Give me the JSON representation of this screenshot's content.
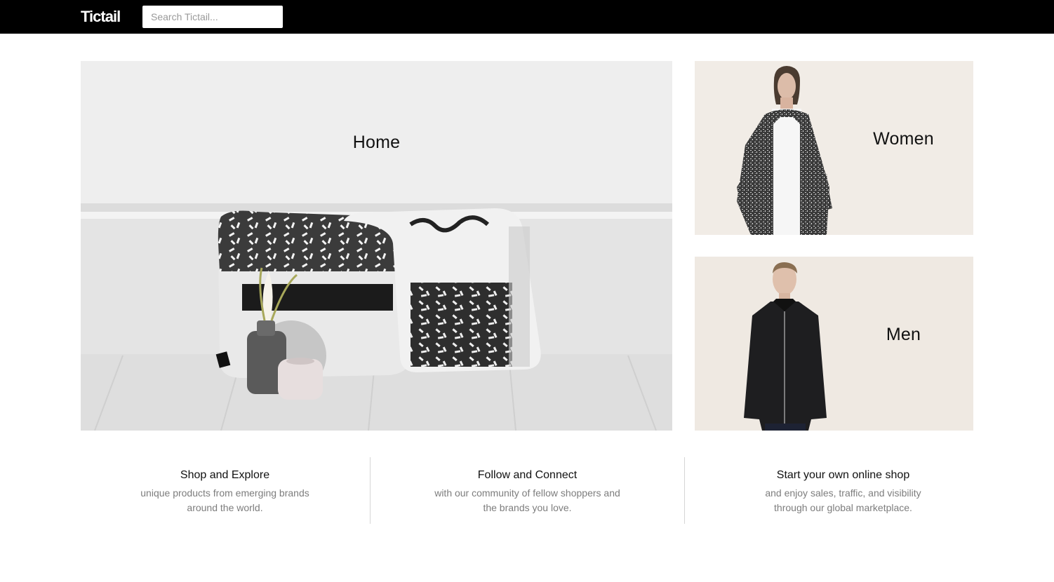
{
  "header": {
    "logo": "Tictail",
    "search_placeholder": "Search Tictail..."
  },
  "tiles": {
    "home": {
      "label": "Home"
    },
    "women": {
      "label": "Women"
    },
    "men": {
      "label": "Men"
    }
  },
  "features": [
    {
      "title": "Shop and Explore",
      "text": "unique products from emerging brands around the world."
    },
    {
      "title": "Follow and Connect",
      "text": "with our community of fellow shoppers and the brands you love."
    },
    {
      "title": "Start your own online shop",
      "text": "and enjoy sales, traffic, and visibility through our global marketplace."
    }
  ],
  "colors": {
    "header_bg": "#000000",
    "tile_women_bg": "#f1ece6",
    "tile_men_bg": "#efe9e2",
    "muted_text": "#7d7d7d"
  }
}
